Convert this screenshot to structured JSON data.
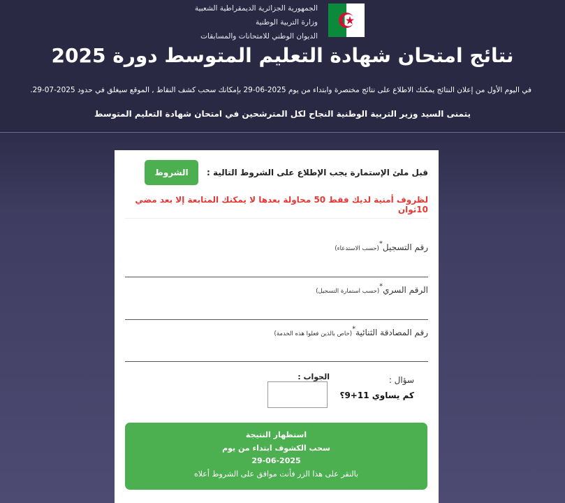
{
  "header": {
    "org_lines": [
      "الجمهورية الجزائرية الديمقراطية الشعبية",
      "وزارة التربية الوطنية",
      "الديوان الوطني للامتحانات والمسابقات"
    ],
    "title": "نتائج امتحان شهادة التعليم المتوسط دورة 2025",
    "notice": "في اليوم الأول من إعلان النتائج يمكنك الاطلاع على نتائج مختصرة وابتداء من يوم 2025-06-29 بإمكانك سحب كشف النقاط , الموقع سيغلق في حدود 2025-07-29.",
    "wish": "يتمنى السيد وزير التربية الوطنية النجاح لكل المترشحين في امتحان شهادة التعليم المتوسط"
  },
  "form": {
    "conditions_label": "قبل ملئ الإستمارة يجب الإطلاع على الشروط التالية :",
    "conditions_button": "الشروط",
    "warning": "لظروف أمنية لديك فقط 50 محاولة بعدها لا يمكنك المتابعة إلا بعد مضي 10ثوان",
    "fields": [
      {
        "label": "رقم التسجيل",
        "hint": "(حسب الاستدعاء)"
      },
      {
        "label": "الرقم السري",
        "hint": "(حسب استمارة التسجيل)"
      },
      {
        "label": "رقم المصادقة الثنائية",
        "hint": "(خاص بالذين فعلوا هذه الخدمة)"
      }
    ],
    "required_mark": "*",
    "question_label": "سؤال :",
    "question_text": "كم يساوي 11+9؟",
    "answer_label": "الجواب :",
    "answer_value": "",
    "submit": {
      "line1": "استظهار النتيجة",
      "line2": "سحب الكشوف ابتداء من يوم",
      "line3": "29-06-2025",
      "line4": "بالنقر على هذا الزر فأنت موافق على الشروط أعلاه"
    }
  },
  "colors": {
    "accent_green": "#4caf50",
    "warning_red": "#e53935",
    "header_bg": "#2a2944"
  }
}
